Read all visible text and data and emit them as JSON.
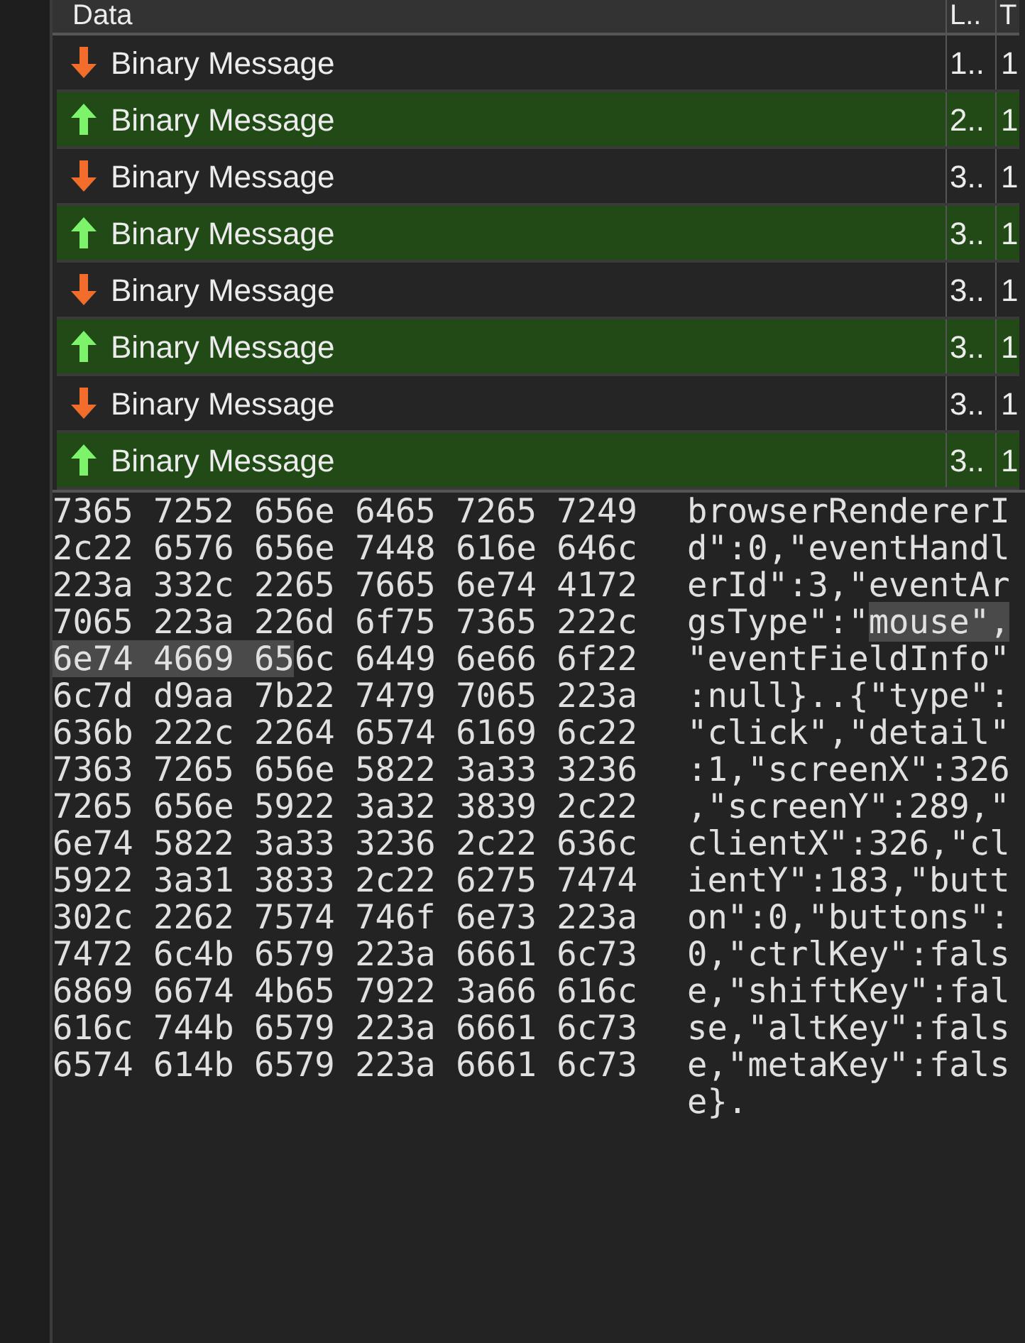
{
  "table": {
    "columns": [
      "Data",
      "L..",
      "T"
    ],
    "rows": [
      {
        "kind": "received",
        "data": "Binary Message",
        "length": "1..",
        "time": "1"
      },
      {
        "kind": "sent",
        "data": "Binary Message",
        "length": "2..",
        "time": "1"
      },
      {
        "kind": "received",
        "data": "Binary Message",
        "length": "3..",
        "time": "1"
      },
      {
        "kind": "sent",
        "data": "Binary Message",
        "length": "3..",
        "time": "1"
      },
      {
        "kind": "received",
        "data": "Binary Message",
        "length": "3..",
        "time": "1"
      },
      {
        "kind": "sent",
        "data": "Binary Message",
        "length": "3..",
        "time": "1"
      },
      {
        "kind": "received",
        "data": "Binary Message",
        "length": "3..",
        "time": "1"
      },
      {
        "kind": "sent",
        "data": "Binary Message",
        "length": "3..",
        "time": "1"
      }
    ]
  },
  "hex_view": {
    "lines": [
      {
        "hex": [
          {
            "text": "7365 7252 656e 6465 7265 7249",
            "selected": false
          }
        ],
        "ascii": [
          {
            "text": "browserRendererI",
            "selected": false
          }
        ]
      },
      {
        "hex": [
          {
            "text": "2c22 6576 656e 7448 616e 646c",
            "selected": false
          }
        ],
        "ascii": [
          {
            "text": "d\":0,\"eventHandl",
            "selected": false
          }
        ]
      },
      {
        "hex": [
          {
            "text": "223a 332c 2265 7665 6e74 4172",
            "selected": false
          }
        ],
        "ascii": [
          {
            "text": "erId\":3,\"eventAr",
            "selected": false
          }
        ]
      },
      {
        "hex": [
          {
            "text": "7065 223a 226d 6f75 7365 222c",
            "selected": false
          }
        ],
        "ascii": [
          {
            "text": "gsType\":\"",
            "selected": false
          },
          {
            "text": "mouse\",",
            "selected": true
          }
        ]
      },
      {
        "hex": [
          {
            "text": "6e74 4669 65",
            "selected": true
          },
          {
            "text": "6c 6449 6e66 6f22",
            "selected": false
          }
        ],
        "ascii": [
          {
            "text": "\"eventFieldInfo\"",
            "selected": false
          }
        ]
      },
      {
        "hex": [
          {
            "text": "6c7d d9aa 7b22 7479 7065 223a",
            "selected": false
          }
        ],
        "ascii": [
          {
            "text": ":null}..{\"type\":",
            "selected": false
          }
        ]
      },
      {
        "hex": [
          {
            "text": "636b 222c 2264 6574 6169 6c22",
            "selected": false
          }
        ],
        "ascii": [
          {
            "text": "\"click\",\"detail\"",
            "selected": false
          }
        ]
      },
      {
        "hex": [
          {
            "text": "7363 7265 656e 5822 3a33 3236",
            "selected": false
          }
        ],
        "ascii": [
          {
            "text": ":1,\"screenX\":326",
            "selected": false
          }
        ]
      },
      {
        "hex": [
          {
            "text": "7265 656e 5922 3a32 3839 2c22",
            "selected": false
          }
        ],
        "ascii": [
          {
            "text": ",\"screenY\":289,\"",
            "selected": false
          }
        ]
      },
      {
        "hex": [
          {
            "text": "6e74 5822 3a33 3236 2c22 636c",
            "selected": false
          }
        ],
        "ascii": [
          {
            "text": "clientX\":326,\"cl",
            "selected": false
          }
        ]
      },
      {
        "hex": [
          {
            "text": "5922 3a31 3833 2c22 6275 7474",
            "selected": false
          }
        ],
        "ascii": [
          {
            "text": "ientY\":183,\"butt",
            "selected": false
          }
        ]
      },
      {
        "hex": [
          {
            "text": "302c 2262 7574 746f 6e73 223a",
            "selected": false
          }
        ],
        "ascii": [
          {
            "text": "on\":0,\"buttons\":",
            "selected": false
          }
        ]
      },
      {
        "hex": [
          {
            "text": "7472 6c4b 6579 223a 6661 6c73",
            "selected": false
          }
        ],
        "ascii": [
          {
            "text": "0,\"ctrlKey\":fals",
            "selected": false
          }
        ]
      },
      {
        "hex": [
          {
            "text": "6869 6674 4b65 7922 3a66 616c",
            "selected": false
          }
        ],
        "ascii": [
          {
            "text": "e,\"shiftKey\":fal",
            "selected": false
          }
        ]
      },
      {
        "hex": [
          {
            "text": "616c 744b 6579 223a 6661 6c73",
            "selected": false
          }
        ],
        "ascii": [
          {
            "text": "se,\"altKey\":fals",
            "selected": false
          }
        ]
      },
      {
        "hex": [
          {
            "text": "6574 614b 6579 223a 6661 6c73",
            "selected": false
          }
        ],
        "ascii": [
          {
            "text": "e,\"metaKey\":fals",
            "selected": false
          }
        ]
      },
      {
        "ascii": [
          {
            "text": "e}.",
            "selected": false
          }
        ]
      }
    ]
  }
}
